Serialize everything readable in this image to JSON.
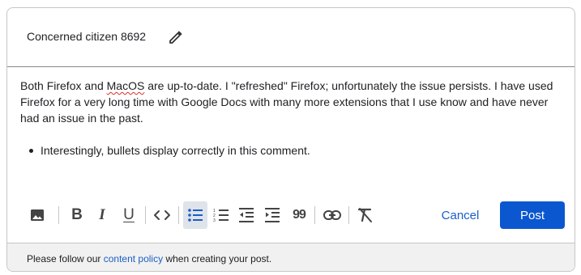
{
  "author": {
    "name": "Concerned citizen 8692",
    "edit_icon": "pencil-icon"
  },
  "comment": {
    "segment1": "Both Firefox and ",
    "misspelled_word": "MacOS",
    "segment2": " are up-to-date.  I \"refreshed\" Firefox; unfortunately the issue persists. I have used Firefox for a very long time with Google Docs with many more extensions that I use know and have never had an issue in the past.",
    "bullets": [
      "Interestingly, bullets display correctly in this comment."
    ]
  },
  "toolbar": {
    "tools": [
      {
        "name": "image-icon"
      },
      {
        "name": "bold-icon",
        "label": "B"
      },
      {
        "name": "italic-icon",
        "label": "I"
      },
      {
        "name": "underline-icon",
        "label": "U"
      },
      {
        "name": "code-icon"
      },
      {
        "name": "bulleted-list-icon",
        "active": true
      },
      {
        "name": "numbered-list-icon"
      },
      {
        "name": "decrease-indent-icon"
      },
      {
        "name": "increase-indent-icon"
      },
      {
        "name": "quote-icon",
        "label": "99"
      },
      {
        "name": "link-icon"
      },
      {
        "name": "clear-formatting-icon"
      }
    ],
    "cancel_label": "Cancel",
    "post_label": "Post"
  },
  "colors": {
    "primary": "#0b57d0",
    "link": "#1a5fc6",
    "active_tool_bg": "#dfe3ea",
    "footer_bg": "#f1f1f1"
  },
  "footer": {
    "prefix": "Please follow our ",
    "link_text": "content policy",
    "suffix": " when creating your post."
  }
}
